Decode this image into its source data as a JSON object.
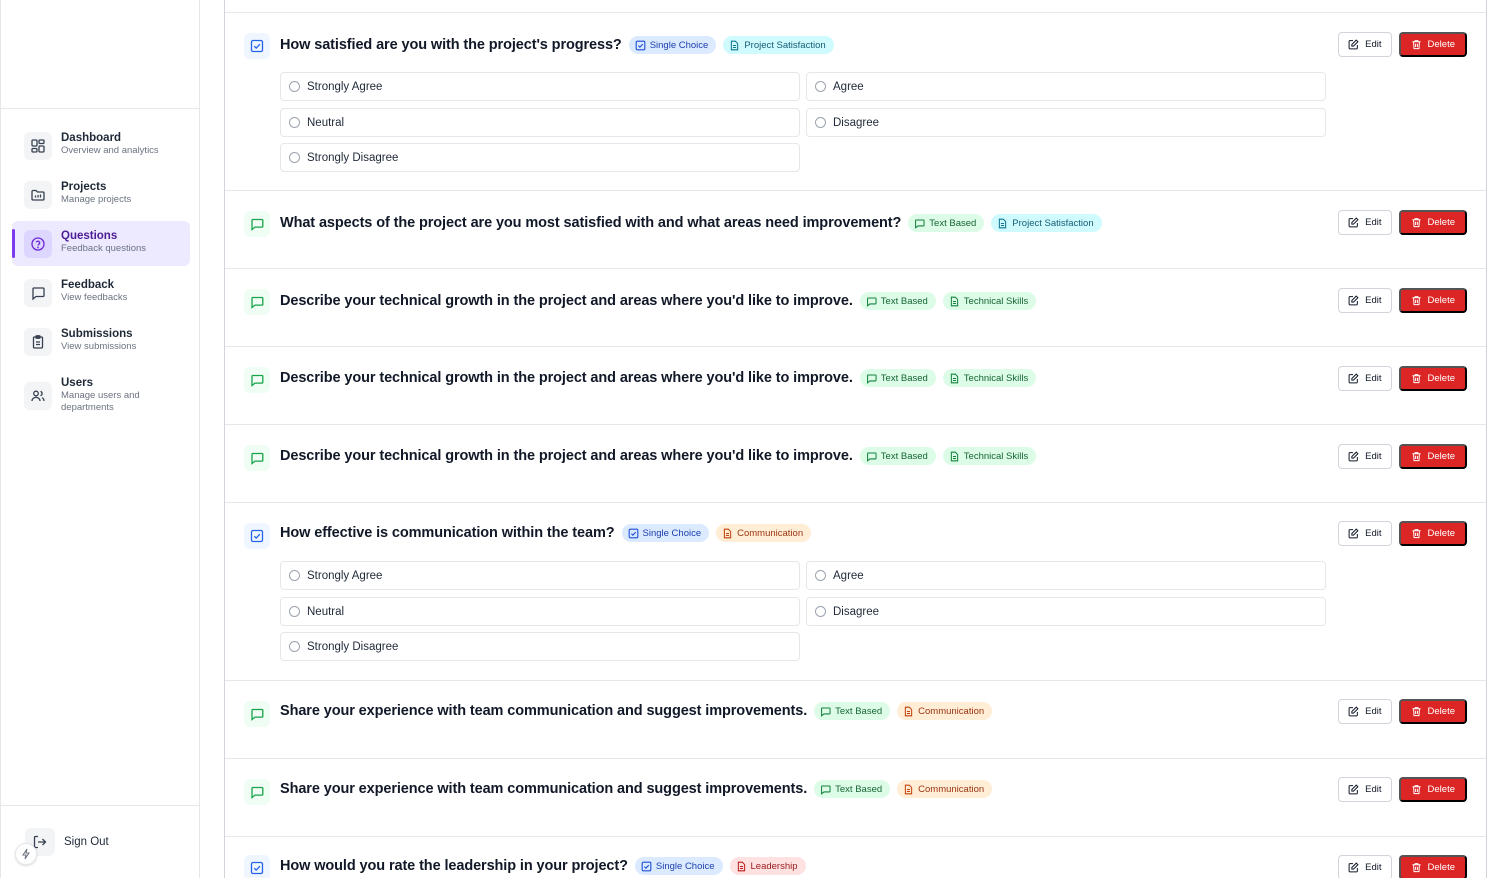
{
  "sidebar": {
    "items": [
      {
        "title": "Dashboard",
        "sub": "Overview and analytics"
      },
      {
        "title": "Projects",
        "sub": "Manage projects"
      },
      {
        "title": "Questions",
        "sub": "Feedback questions"
      },
      {
        "title": "Feedback",
        "sub": "View feedbacks"
      },
      {
        "title": "Submissions",
        "sub": "View submissions"
      },
      {
        "title": "Users",
        "sub": "Manage users and departments"
      }
    ],
    "active_item": "Questions",
    "sign_out": "Sign Out"
  },
  "buttons": {
    "edit": "Edit",
    "delete": "Delete"
  },
  "badges": {
    "single_choice": "Single Choice",
    "text_based": "Text Based",
    "project_satisfaction": "Project Satisfaction",
    "technical_skills": "Technical Skills",
    "communication": "Communication",
    "leadership": "Leadership"
  },
  "options": [
    "Strongly Agree",
    "Agree",
    "Neutral",
    "Disagree",
    "Strongly Disagree"
  ],
  "questions": [
    {
      "title": "How satisfied are you with the project's progress?",
      "type": "Single Choice",
      "category": "Project Satisfaction"
    },
    {
      "title": "What aspects of the project are you most satisfied with and what areas need improvement?",
      "type": "Text Based",
      "category": "Project Satisfaction"
    },
    {
      "title": "Describe your technical growth in the project and areas where you'd like to improve.",
      "type": "Text Based",
      "category": "Technical Skills"
    },
    {
      "title": "Describe your technical growth in the project and areas where you'd like to improve.",
      "type": "Text Based",
      "category": "Technical Skills"
    },
    {
      "title": "Describe your technical growth in the project and areas where you'd like to improve.",
      "type": "Text Based",
      "category": "Technical Skills"
    },
    {
      "title": "How effective is communication within the team?",
      "type": "Single Choice",
      "category": "Communication"
    },
    {
      "title": "Share your experience with team communication and suggest improvements.",
      "type": "Text Based",
      "category": "Communication"
    },
    {
      "title": "Share your experience with team communication and suggest improvements.",
      "type": "Text Based",
      "category": "Communication"
    },
    {
      "title": "How would you rate the leadership in your project?",
      "type": "Single Choice",
      "category": "Leadership"
    }
  ],
  "colors": {
    "accent": "#7c3aed",
    "delete": "#dc2626",
    "single_choice_badge": "#dbeafe",
    "text_based_badge": "#dcfce7",
    "project_satisfaction_badge": "#cffafe",
    "communication_badge": "#ffedd5",
    "leadership_badge": "#fee2e2"
  },
  "icons": {
    "dashboard": "grid-icon",
    "projects": "folder-icon",
    "questions": "help-circle-icon",
    "feedback": "message-icon",
    "submissions": "clipboard-icon",
    "users": "users-icon",
    "sign_out": "log-out-icon",
    "single_choice": "check-square-icon",
    "text_based": "message-square-icon",
    "category": "file-text-icon",
    "edit": "edit-icon",
    "delete": "trash-icon"
  }
}
